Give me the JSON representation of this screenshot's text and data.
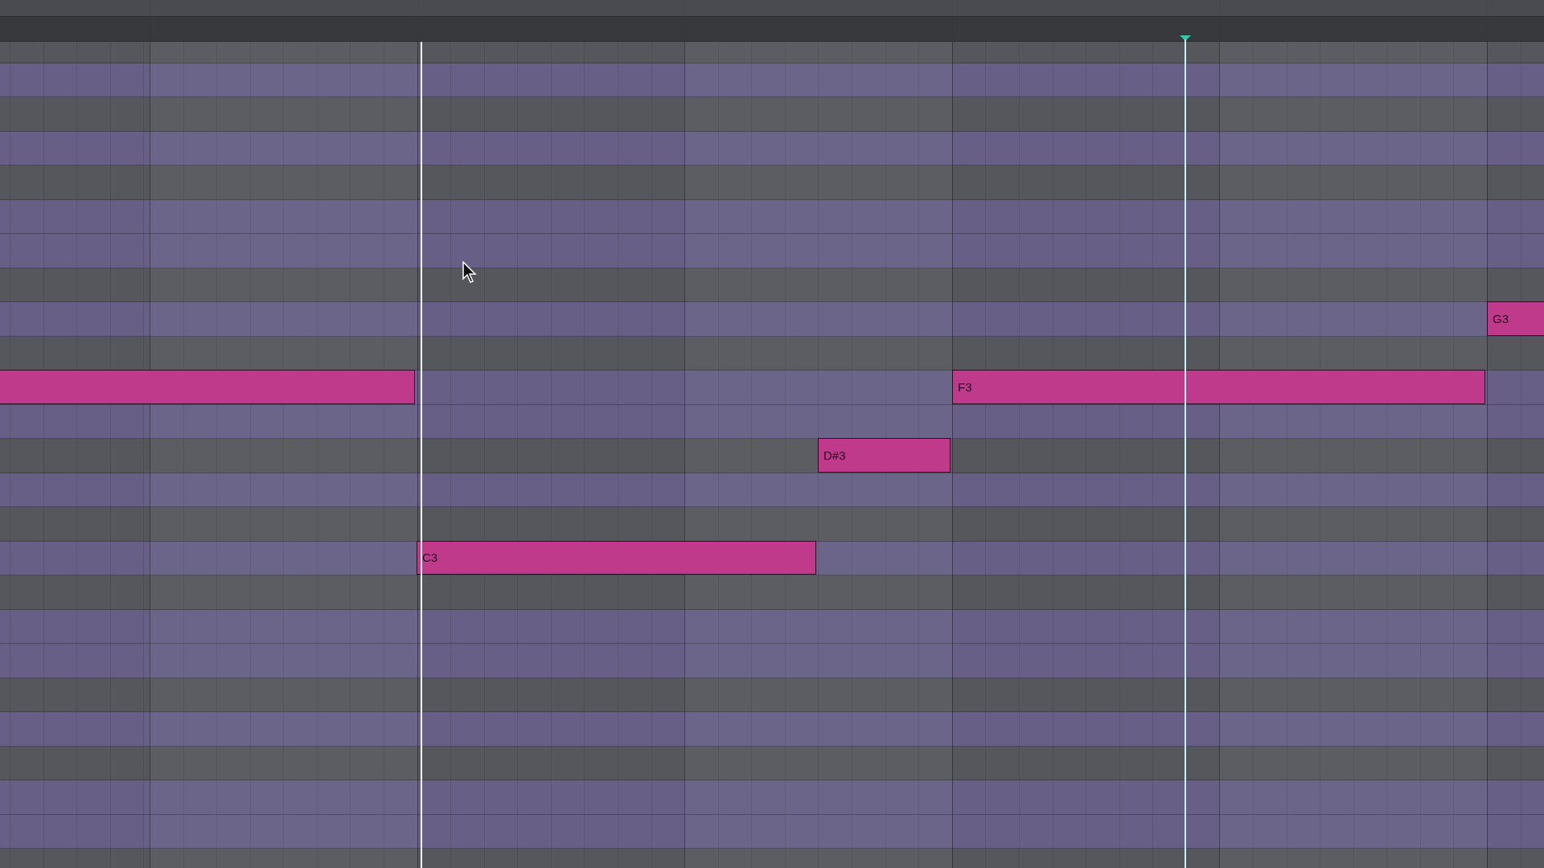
{
  "piano_roll": {
    "rows": [
      {
        "kind": "dark"
      },
      {
        "kind": "light"
      },
      {
        "kind": "dark"
      },
      {
        "kind": "light"
      },
      {
        "kind": "dark"
      },
      {
        "kind": "light"
      },
      {
        "kind": "light"
      },
      {
        "kind": "dark"
      },
      {
        "kind": "light",
        "notes": [
          {
            "kind": "note",
            "label": "G3"
          }
        ]
      },
      {
        "kind": "dark"
      },
      {
        "kind": "light",
        "notes": [
          {
            "kind": "note"
          },
          {
            "kind": "note",
            "label": "F3"
          }
        ]
      },
      {
        "kind": "light"
      },
      {
        "kind": "dark",
        "notes": [
          {
            "kind": "note",
            "label": "D#3"
          }
        ]
      },
      {
        "kind": "light"
      },
      {
        "kind": "dark"
      },
      {
        "kind": "light",
        "notes": [
          {
            "kind": "note",
            "label": "C3"
          }
        ]
      },
      {
        "kind": "dark"
      },
      {
        "kind": "light"
      },
      {
        "kind": "light"
      },
      {
        "kind": "dark"
      },
      {
        "kind": "light"
      },
      {
        "kind": "dark"
      },
      {
        "kind": "light"
      },
      {
        "kind": "light"
      },
      {
        "kind": "dark"
      }
    ]
  }
}
